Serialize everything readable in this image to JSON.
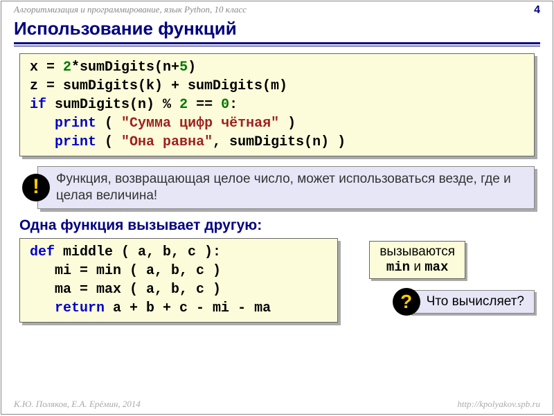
{
  "header": {
    "course": "Алгоритмизация и программирование, язык Python, 10 класс",
    "page": "4"
  },
  "title": "Использование функций",
  "code1": {
    "l1a": "x = ",
    "l1b": "2",
    "l1c": "*sumDigits(n+",
    "l1d": "5",
    "l1e": ")",
    "l2": "z = sumDigits(k) + sumDigits(m)",
    "l3a": "if",
    "l3b": " sumDigits(n)",
    "l3c": " % ",
    "l3d": "2",
    "l3e": " == ",
    "l3f": "0",
    "l3g": ":",
    "l4a": "   ",
    "l4b": "print",
    "l4c": " ( ",
    "l4d": "\"Сумма цифр чётная\"",
    "l4e": " )",
    "l5a": "   ",
    "l5b": "print",
    "l5c": " ( ",
    "l5d": "\"Она равна\"",
    "l5e": ", sumDigits(n) )"
  },
  "info": {
    "badge": "!",
    "text": "Функция, возвращающая целое число, может использоваться везде, где и целая величина!"
  },
  "subtitle": "Одна функция вызывает другую:",
  "code2": {
    "l1a": "def",
    "l1b": " middle ( a, b, c ):",
    "l2": "   mi = min ( a, b, c )",
    "l3": "   ma = max ( a, b, c )",
    "l4a": "   ",
    "l4b": "return",
    "l4c": " a + b + c - mi - ma"
  },
  "sidebox": {
    "line1": "вызываются",
    "min": "min",
    "and": " и ",
    "max": "max"
  },
  "question": {
    "badge": "?",
    "text": "Что вычисляет?"
  },
  "footer": {
    "left": "К.Ю. Поляков, Е.А. Ерёмин, 2014",
    "right": "http://kpolyakov.spb.ru"
  }
}
